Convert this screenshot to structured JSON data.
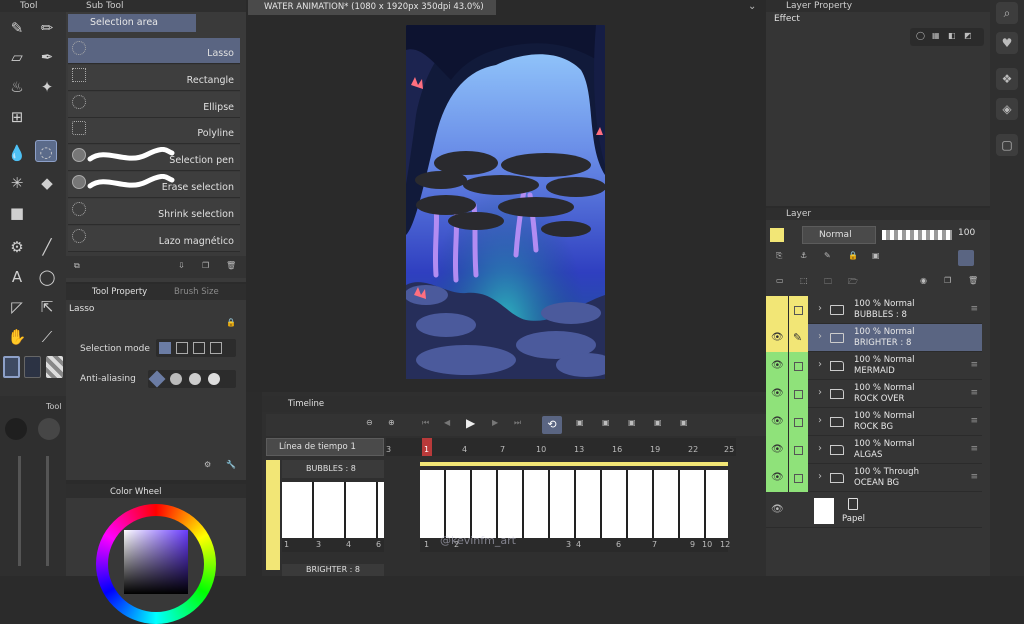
{
  "toolbar": {
    "title": "Tool"
  },
  "subtool": {
    "title": "Sub Tool",
    "group": "Selection area",
    "items": [
      {
        "label": "Lasso",
        "selected": true
      },
      {
        "label": "Rectangle"
      },
      {
        "label": "Ellipse"
      },
      {
        "label": "Polyline"
      },
      {
        "label": "Selection pen"
      },
      {
        "label": "Erase selection"
      },
      {
        "label": "Shrink selection"
      },
      {
        "label": "Lazo magnético"
      }
    ]
  },
  "document": {
    "tab_title": "WATER ANIMATION* (1080 x 1920px 350dpi 43.0%)"
  },
  "tool_property": {
    "tab1": "Tool Property",
    "tab2": "Brush Size",
    "tool_name": "Lasso",
    "selection_mode_label": "Selection mode",
    "anti_aliasing_label": "Anti-aliasing"
  },
  "color_wheel": {
    "title": "Color Wheel"
  },
  "layer_property": {
    "title": "Layer Property",
    "effect_label": "Effect"
  },
  "layer_panel": {
    "title": "Layer",
    "blend_mode": "Normal",
    "opacity": "100",
    "layers": [
      {
        "line1": "100 % Normal",
        "line2": "BUBBLES : 8",
        "color": "#f2e676",
        "selected": false
      },
      {
        "line1": "100 % Normal",
        "line2": "BRIGHTER : 8",
        "color": "#f2e676",
        "selected": true
      },
      {
        "line1": "100 % Normal",
        "line2": "MERMAID",
        "color": "#8fe27a",
        "selected": false
      },
      {
        "line1": "100 % Normal",
        "line2": "ROCK OVER",
        "color": "#8fe27a",
        "selected": false
      },
      {
        "line1": "100 % Normal",
        "line2": "ROCK BG",
        "color": "#8fe27a",
        "selected": false
      },
      {
        "line1": "100 % Normal",
        "line2": "ALGAS",
        "color": "#8fe27a",
        "selected": false
      },
      {
        "line1": "100 % Through",
        "line2": "OCEAN BG",
        "color": "#8fe27a",
        "selected": false
      }
    ],
    "paper_label": "Papel"
  },
  "timeline": {
    "title": "Timeline",
    "timeline_name": "Línea de tiempo 1",
    "track1": "BUBBLES : 8",
    "track2": "BRIGHTER : 8",
    "ruler_numbers": [
      "3",
      "1",
      "4",
      "7",
      "10",
      "13",
      "16",
      "19",
      "22",
      "25"
    ],
    "left_cell_numbers": [
      "1",
      "3",
      "4",
      "6"
    ],
    "right_cell_numbers": [
      "1",
      "2",
      "3",
      "4",
      "6",
      "7",
      "9",
      "10",
      "12"
    ],
    "watermark": "@kevinfm_art"
  },
  "colors": {
    "accent": "#5a6582",
    "yellow": "#f2e676",
    "green": "#8fe27a"
  }
}
